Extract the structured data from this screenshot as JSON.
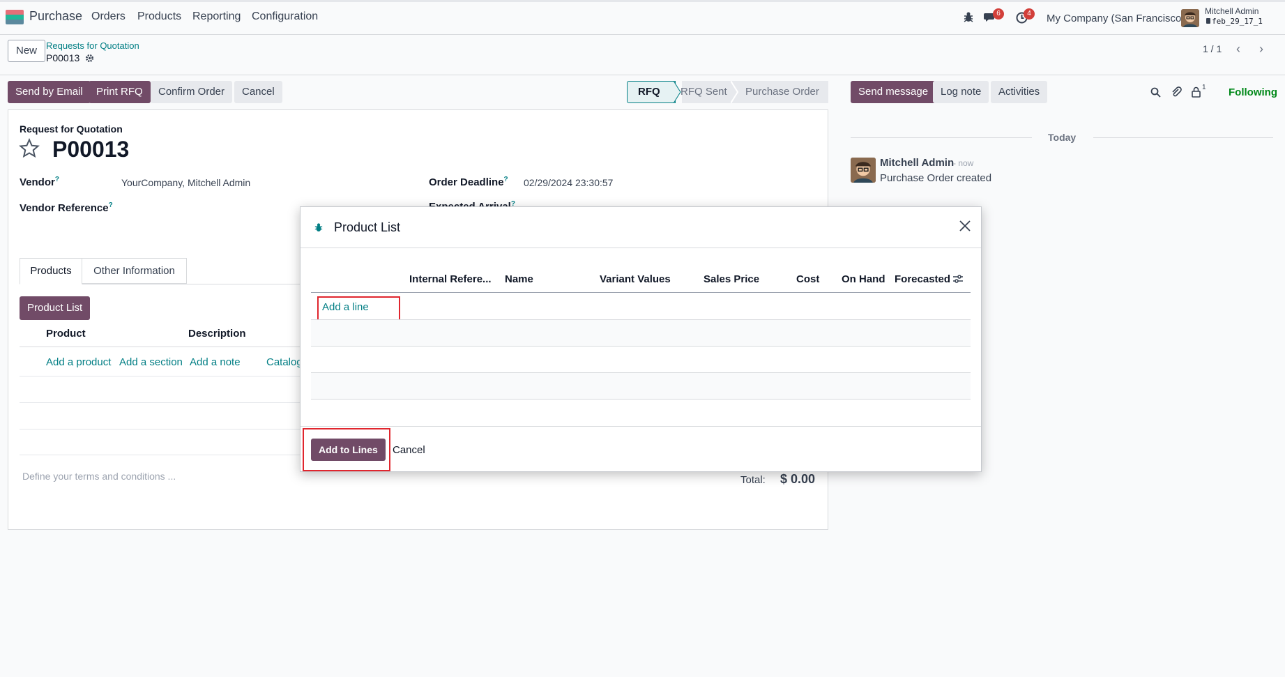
{
  "navbar": {
    "app_name": "Purchase",
    "menu": [
      "Orders",
      "Products",
      "Reporting",
      "Configuration"
    ],
    "messages_count": "6",
    "activities_count": "4",
    "company": "My Company (San Francisco)",
    "user_name": "Mitchell Admin",
    "db_name": "feb_29_17_1",
    "brand_colors": [
      "#e46f78",
      "#21b799",
      "#5b899e"
    ]
  },
  "control": {
    "new_label": "New",
    "breadcrumb_parent": "Requests for Quotation",
    "breadcrumb_current": "P00013",
    "pager": "1 / 1"
  },
  "actions": {
    "send_email": "Send by Email",
    "print_rfq": "Print RFQ",
    "confirm": "Confirm Order",
    "cancel": "Cancel"
  },
  "status": {
    "steps": [
      "RFQ",
      "RFQ Sent",
      "Purchase Order"
    ],
    "active": "RFQ"
  },
  "chatter": {
    "send_message": "Send message",
    "log_note": "Log note",
    "activities": "Activities",
    "followers_count": "1",
    "following": "Following",
    "today": "Today",
    "author": "Mitchell Admin",
    "time": "- now",
    "message": "Purchase Order created"
  },
  "form": {
    "doc_type": "Request for Quotation",
    "name": "P00013",
    "vendor_label": "Vendor",
    "vendor_value": "YourCompany, Mitchell Admin",
    "vendor_ref_label": "Vendor Reference",
    "deadline_label": "Order Deadline",
    "deadline_value": "02/29/2024 23:30:57",
    "expected_label": "Expected Arrival",
    "tabs": [
      "Products",
      "Other Information"
    ],
    "product_list_button": "Product List",
    "columns": [
      "Product",
      "Description"
    ],
    "add_product": "Add a product",
    "add_section": "Add a section",
    "add_note": "Add a note",
    "catalog": "Catalog",
    "terms_placeholder": "Define your terms and conditions ...",
    "total_label": "Total:",
    "total_value": "$ 0.00"
  },
  "modal": {
    "title": "Product List",
    "columns": [
      "Internal Refere...",
      "Name",
      "Variant Values",
      "Sales Price",
      "Cost",
      "On Hand",
      "Forecasted"
    ],
    "add_line": "Add a line",
    "add_to_lines": "Add to Lines",
    "cancel": "Cancel"
  }
}
